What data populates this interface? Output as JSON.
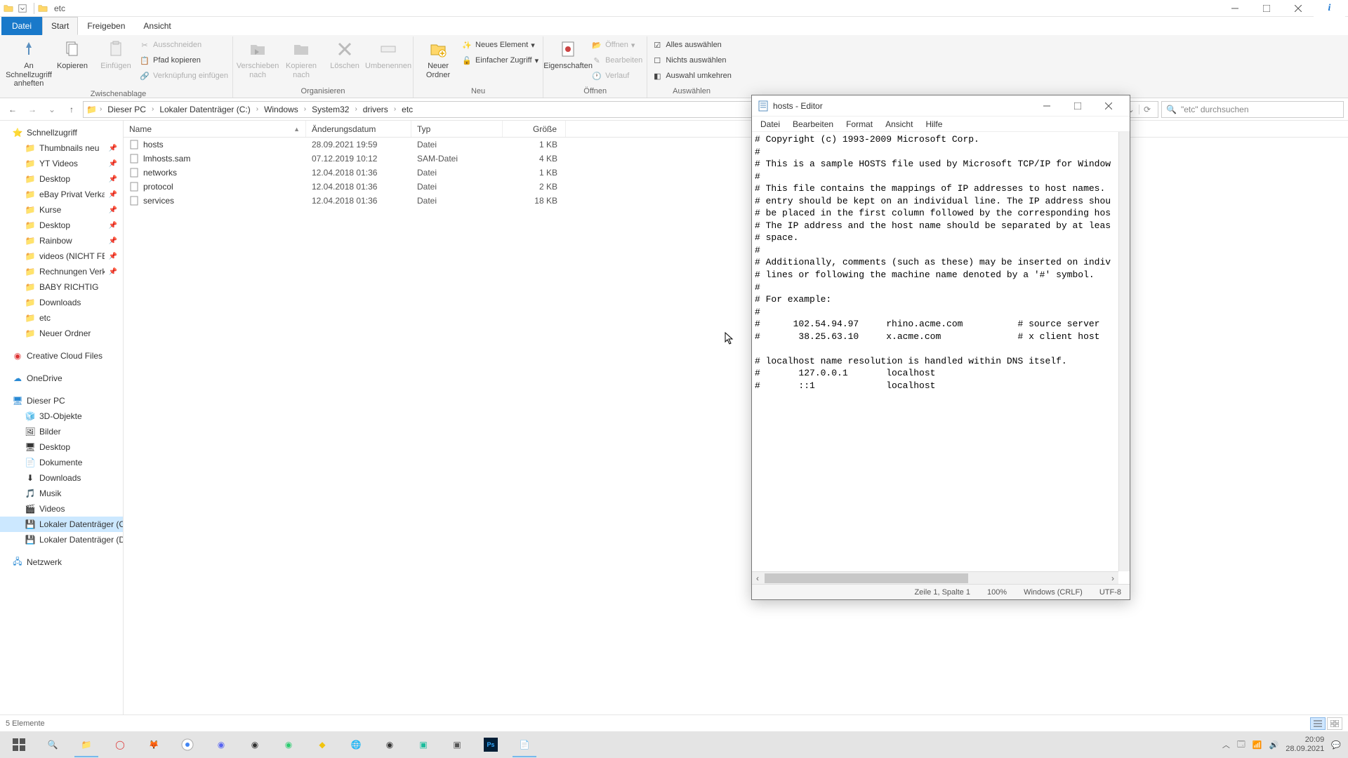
{
  "titlebar": {
    "title": "etc"
  },
  "tabs": {
    "file": "Datei",
    "start": "Start",
    "share": "Freigeben",
    "view": "Ansicht"
  },
  "ribbon": {
    "clipboard": {
      "label": "Zwischenablage",
      "pin": "An Schnellzugriff anheften",
      "copy": "Kopieren",
      "paste": "Einfügen",
      "cut": "Ausschneiden",
      "copypath": "Pfad kopieren",
      "pastelink": "Verknüpfung einfügen"
    },
    "organize": {
      "label": "Organisieren",
      "moveto": "Verschieben nach",
      "copyto": "Kopieren nach",
      "delete": "Löschen",
      "rename": "Umbenennen"
    },
    "new": {
      "label": "Neu",
      "newfolder": "Neuer Ordner",
      "newitem": "Neues Element",
      "easyaccess": "Einfacher Zugriff"
    },
    "open": {
      "label": "Öffnen",
      "properties": "Eigenschaften",
      "open": "Öffnen",
      "edit": "Bearbeiten",
      "history": "Verlauf"
    },
    "select": {
      "label": "Auswählen",
      "selectall": "Alles auswählen",
      "selectnone": "Nichts auswählen",
      "invert": "Auswahl umkehren"
    }
  },
  "breadcrumbs": [
    "Dieser PC",
    "Lokaler Datenträger (C:)",
    "Windows",
    "System32",
    "drivers",
    "etc"
  ],
  "search": {
    "placeholder": "\"etc\" durchsuchen"
  },
  "columns": {
    "name": "Name",
    "date": "Änderungsdatum",
    "type": "Typ",
    "size": "Größe"
  },
  "files": [
    {
      "name": "hosts",
      "date": "28.09.2021 19:59",
      "type": "Datei",
      "size": "1 KB"
    },
    {
      "name": "lmhosts.sam",
      "date": "07.12.2019 10:12",
      "type": "SAM-Datei",
      "size": "4 KB"
    },
    {
      "name": "networks",
      "date": "12.04.2018 01:36",
      "type": "Datei",
      "size": "1 KB"
    },
    {
      "name": "protocol",
      "date": "12.04.2018 01:36",
      "type": "Datei",
      "size": "2 KB"
    },
    {
      "name": "services",
      "date": "12.04.2018 01:36",
      "type": "Datei",
      "size": "18 KB"
    }
  ],
  "sidebar": {
    "quick": "Schnellzugriff",
    "items1": [
      "Thumbnails neu",
      "YT Videos",
      "Desktop",
      "eBay Privat Verkauf",
      "Kurse",
      "Desktop",
      "Rainbow",
      "videos (NICHT FERT",
      "Rechnungen Verkau",
      "BABY RICHTIG",
      "Downloads",
      "etc",
      "Neuer Ordner"
    ],
    "ccf": "Creative Cloud Files",
    "onedrive": "OneDrive",
    "thispc": "Dieser PC",
    "pcitems": [
      "3D-Objekte",
      "Bilder",
      "Desktop",
      "Dokumente",
      "Downloads",
      "Musik",
      "Videos",
      "Lokaler Datenträger (C",
      "Lokaler Datenträger (D"
    ],
    "network": "Netzwerk"
  },
  "status": {
    "count": "5 Elemente"
  },
  "notepad": {
    "title": "hosts - Editor",
    "menu": [
      "Datei",
      "Bearbeiten",
      "Format",
      "Ansicht",
      "Hilfe"
    ],
    "content": "# Copyright (c) 1993-2009 Microsoft Corp.\n#\n# This is a sample HOSTS file used by Microsoft TCP/IP for Window\n#\n# This file contains the mappings of IP addresses to host names.\n# entry should be kept on an individual line. The IP address shou\n# be placed in the first column followed by the corresponding hos\n# The IP address and the host name should be separated by at leas\n# space.\n#\n# Additionally, comments (such as these) may be inserted on indiv\n# lines or following the machine name denoted by a '#' symbol.\n#\n# For example:\n#\n#      102.54.94.97     rhino.acme.com          # source server\n#       38.25.63.10     x.acme.com              # x client host\n\n# localhost name resolution is handled within DNS itself.\n#       127.0.0.1       localhost\n#       ::1             localhost",
    "status": {
      "pos": "Zeile 1, Spalte 1",
      "zoom": "100%",
      "eol": "Windows (CRLF)",
      "enc": "UTF-8"
    }
  },
  "tray": {
    "time": "20:09",
    "date": "28.09.2021"
  }
}
